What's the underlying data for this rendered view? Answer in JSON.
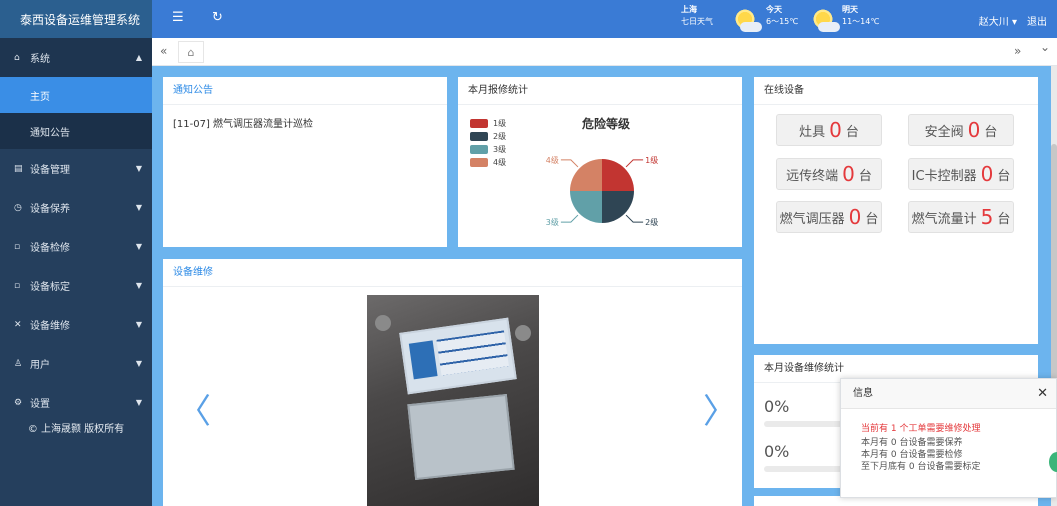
{
  "app": {
    "title": "泰西设备运维管理系统"
  },
  "topbar": {
    "menu_icon": "menu-icon",
    "refresh_icon": "refresh-icon",
    "weather": {
      "city": "上海",
      "forecast_label": "七日天气",
      "today_label": "今天",
      "today_temp": "6～15℃",
      "tomorrow_label": "明天",
      "tomorrow_temp": "11～14℃"
    },
    "user_name": "赵大川",
    "logout_label": "退出"
  },
  "sidebar": {
    "items": [
      {
        "label": "系统",
        "icon": "home-icon"
      },
      {
        "label": "主页"
      },
      {
        "label": "通知公告"
      },
      {
        "label": "设备管理",
        "icon": "device-icon"
      },
      {
        "label": "设备保养",
        "icon": "clock-icon"
      },
      {
        "label": "设备检修",
        "icon": "inspect-icon"
      },
      {
        "label": "设备标定",
        "icon": "calibrate-icon"
      },
      {
        "label": "设备维修",
        "icon": "wrench-icon"
      },
      {
        "label": "用户",
        "icon": "user-icon"
      },
      {
        "label": "设置",
        "icon": "gear-icon"
      }
    ],
    "copyright": "© 上海晟颢 版权所有"
  },
  "tabs": {
    "prev_icon": "«",
    "next_icon": "»",
    "home_icon": "⌂",
    "dropdown_icon": "⌄"
  },
  "notice_panel": {
    "title": "通知公告",
    "items": [
      "[11-07] 燃气调压器流量计巡检"
    ]
  },
  "chart_panel": {
    "title": "本月报修统计"
  },
  "chart_data": {
    "type": "pie",
    "title": "危险等级",
    "categories": [
      "1级",
      "2级",
      "3级",
      "4级"
    ],
    "values": [
      25,
      25,
      25,
      25
    ],
    "colors": [
      "#c23531",
      "#2f4554",
      "#61a0a8",
      "#d48265"
    ],
    "legend_position": "top-left"
  },
  "online_panel": {
    "title": "在线设备",
    "devices": [
      {
        "name": "灶具",
        "count": "0",
        "unit": "台"
      },
      {
        "name": "安全阀",
        "count": "0",
        "unit": "台"
      },
      {
        "name": "远传终端",
        "count": "0",
        "unit": "台"
      },
      {
        "name": "IC卡控制器",
        "count": "0",
        "unit": "台"
      },
      {
        "name": "燃气调压器",
        "count": "0",
        "unit": "台"
      },
      {
        "name": "燃气流量计",
        "count": "5",
        "unit": "台"
      }
    ]
  },
  "repair_panel": {
    "title": "设备维修"
  },
  "monthly_stats": {
    "title": "本月设备维修统计",
    "values": [
      "0%",
      "0%"
    ]
  },
  "popup": {
    "title": "信息",
    "warning": "当前有 1 个工单需要维修处理",
    "lines": [
      "本月有 0 台设备需要保养",
      "本月有 0 台设备需要检修",
      "至下月底有 0 台设备需要标定"
    ]
  }
}
